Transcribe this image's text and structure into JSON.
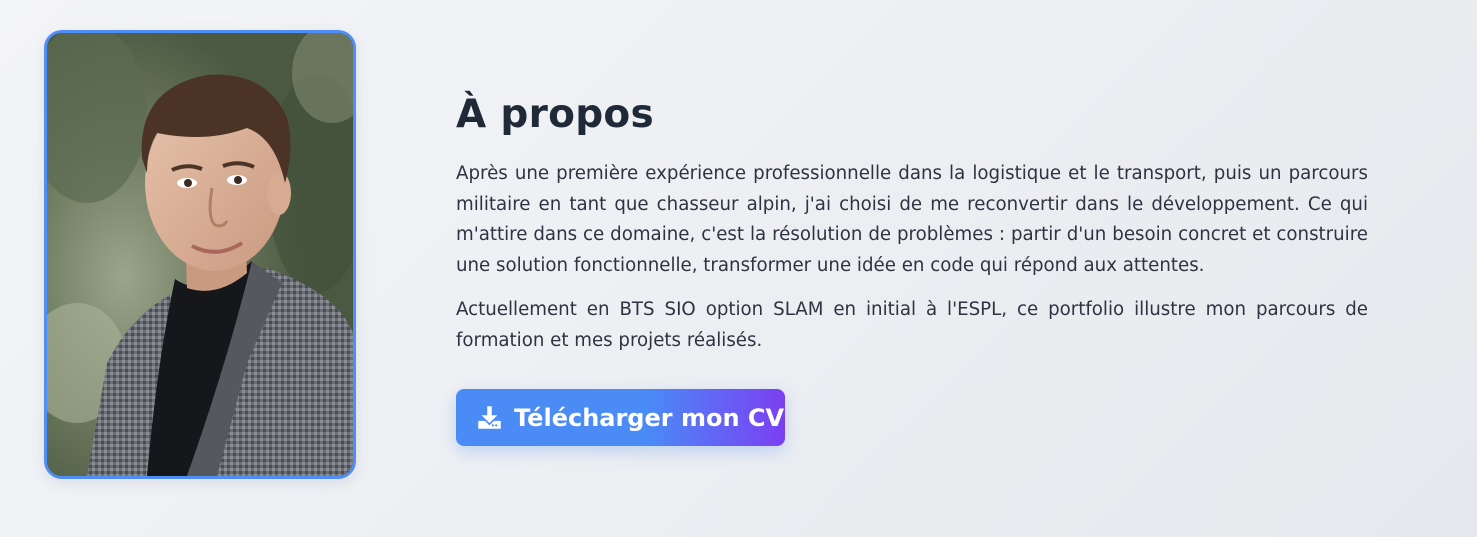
{
  "about": {
    "title": "À propos",
    "paragraphs": [
      "Après une première expérience professionnelle dans la logistique et le transport, puis un parcours militaire en tant que chasseur alpin, j'ai choisi de me reconvertir dans le développement. Ce qui m'attire dans ce domaine, c'est la résolution de problèmes : partir d'un besoin concret et construire une solution fonctionnelle, transformer une idée en code qui répond aux attentes.",
      "Actuellement en BTS SIO option SLAM en initial à l'ESPL, ce portfolio illustre mon parcours de formation et mes projets réalisés."
    ],
    "cv_button": {
      "label": "Télécharger mon CV",
      "icon": "download-icon"
    }
  },
  "photo": {
    "icon": "profile-photo"
  },
  "colors": {
    "accent": "#4a8bf6",
    "accent_end": "#7b3ff0",
    "frame_border": "#4f8ef7",
    "text": "#1f2937"
  }
}
